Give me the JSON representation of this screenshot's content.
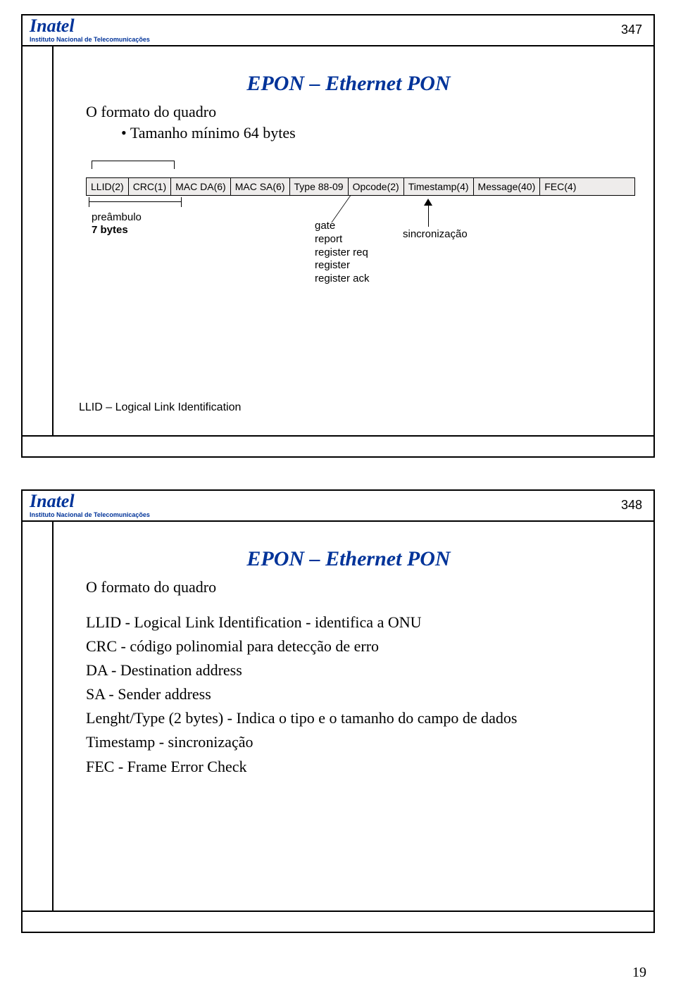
{
  "logo": {
    "name": "Inatel",
    "sub": "Instituto Nacional de Telecomunicações"
  },
  "pageNumber": "19",
  "slide1": {
    "num": "347",
    "title": "EPON – Ethernet PON",
    "heading": "O formato do quadro",
    "bullet": "Tamanho mínimo 64 bytes",
    "fields": [
      "LLID(2)",
      "CRC(1)",
      "MAC DA(6)",
      "MAC SA(6)",
      "Type 88-09",
      "Opcode(2)",
      "Timestamp(4)",
      "Message(40)",
      "FEC(4)"
    ],
    "preamble": {
      "l1": "preâmbulo",
      "l2": "7 bytes"
    },
    "opcodeList": [
      "gate",
      "report",
      "register req",
      "register",
      "register ack"
    ],
    "sync": "sincronização",
    "llidNote": "LLID – Logical Link Identification"
  },
  "slide2": {
    "num": "348",
    "title": "EPON – Ethernet PON",
    "heading": "O formato do quadro",
    "defs": [
      "LLID - Logical Link Identification - identifica a ONU",
      "CRC - código polinomial para detecção de erro",
      "DA - Destination address",
      "SA - Sender address",
      "Lenght/Type (2 bytes) - Indica o tipo e o tamanho do campo de dados",
      "Timestamp - sincronização",
      "FEC - Frame Error Check"
    ]
  }
}
